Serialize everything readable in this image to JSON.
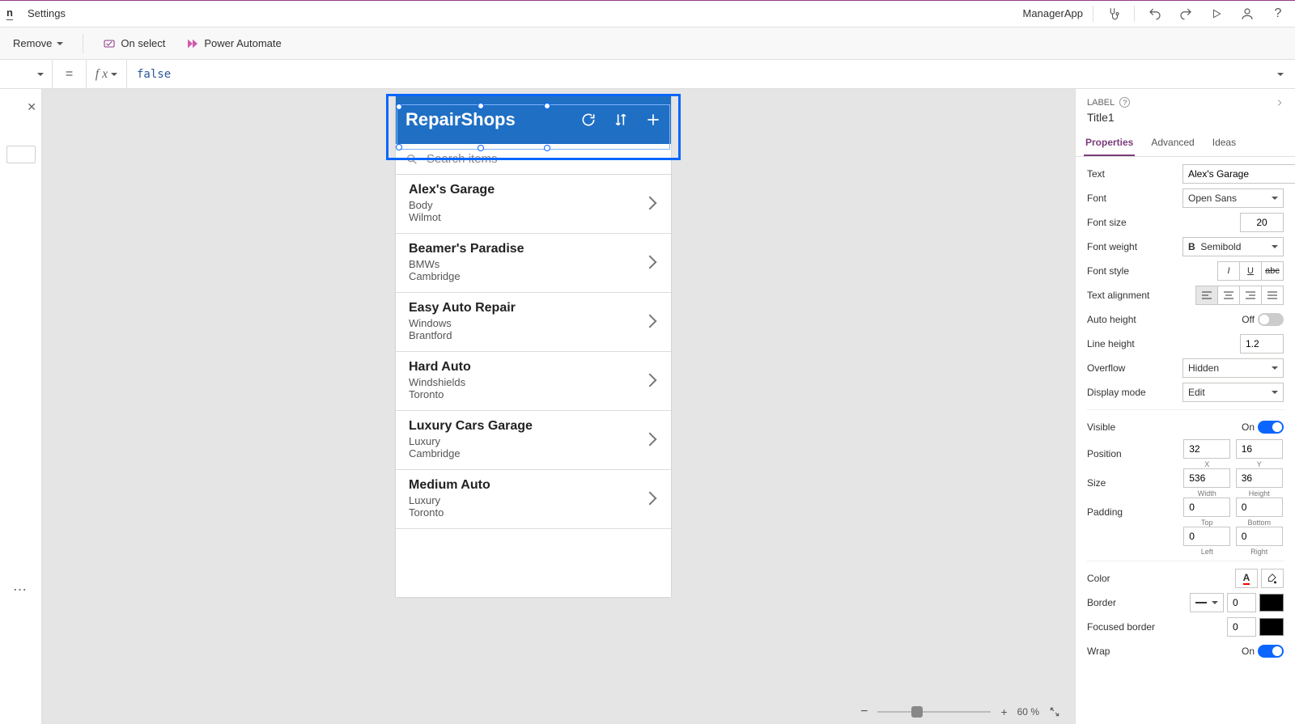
{
  "topmenu": {
    "settings": "Settings",
    "appname": "ManagerApp"
  },
  "ribbon": {
    "remove": "Remove",
    "onselect": "On select",
    "power_automate": "Power Automate"
  },
  "formula": {
    "value": "false"
  },
  "app": {
    "header_title": "RepairShops",
    "search_placeholder": "Search items",
    "items": [
      {
        "name": "Alex's Garage",
        "line2": "Body",
        "line3": "Wilmot"
      },
      {
        "name": "Beamer's Paradise",
        "line2": "BMWs",
        "line3": "Cambridge"
      },
      {
        "name": "Easy Auto Repair",
        "line2": "Windows",
        "line3": "Brantford"
      },
      {
        "name": "Hard Auto",
        "line2": "Windshields",
        "line3": "Toronto"
      },
      {
        "name": "Luxury Cars Garage",
        "line2": "Luxury",
        "line3": "Cambridge"
      },
      {
        "name": "Medium Auto",
        "line2": "Luxury",
        "line3": "Toronto"
      }
    ]
  },
  "props": {
    "label_caption": "LABEL",
    "control_name": "Title1",
    "tabs": {
      "properties": "Properties",
      "advanced": "Advanced",
      "ideas": "Ideas"
    },
    "text_label": "Text",
    "text_value": "Alex's Garage",
    "font_label": "Font",
    "font_value": "Open Sans",
    "fontsize_label": "Font size",
    "fontsize_value": "20",
    "fontweight_label": "Font weight",
    "fontweight_value": "Semibold",
    "fontstyle_label": "Font style",
    "textalign_label": "Text alignment",
    "autoheight_label": "Auto height",
    "autoheight_state": "Off",
    "lineheight_label": "Line height",
    "lineheight_value": "1.2",
    "overflow_label": "Overflow",
    "overflow_value": "Hidden",
    "displaymode_label": "Display mode",
    "displaymode_value": "Edit",
    "visible_label": "Visible",
    "visible_state": "On",
    "position_label": "Position",
    "pos_x": "32",
    "pos_y": "16",
    "x_caption": "X",
    "y_caption": "Y",
    "size_label": "Size",
    "size_w": "536",
    "size_h": "36",
    "w_caption": "Width",
    "h_caption": "Height",
    "padding_label": "Padding",
    "pad_top": "0",
    "pad_bottom": "0",
    "pad_left": "0",
    "pad_right": "0",
    "top_caption": "Top",
    "bottom_caption": "Bottom",
    "left_caption": "Left",
    "right_caption": "Right",
    "color_label": "Color",
    "border_label": "Border",
    "border_value": "0",
    "focusedborder_label": "Focused border",
    "focusedborder_value": "0",
    "wrap_label": "Wrap",
    "wrap_state": "On"
  },
  "zoom": {
    "percent": "60",
    "suffix": "%"
  }
}
